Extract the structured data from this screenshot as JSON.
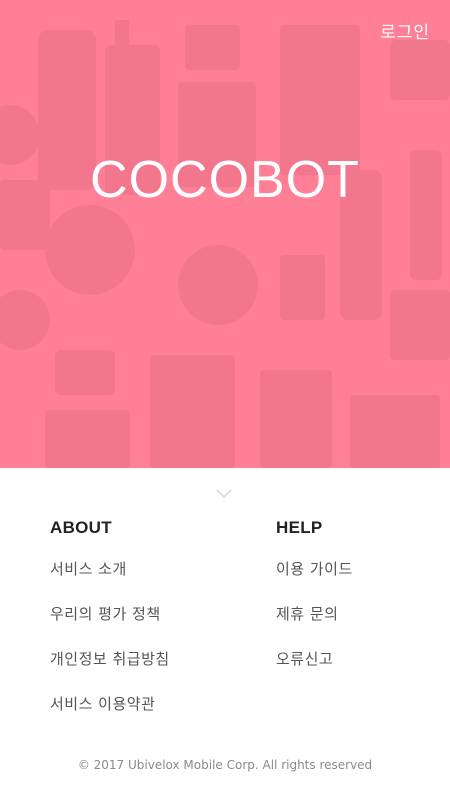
{
  "header": {
    "login_label": "로그인"
  },
  "hero": {
    "brand": "COCOBOT"
  },
  "about": {
    "title": "ABOUT",
    "items": [
      "서비스 소개",
      "우리의 평가 정책",
      "개인정보 취급방침",
      "서비스 이용약관"
    ]
  },
  "help": {
    "title": "HELP",
    "items": [
      "이용 가이드",
      "제휴 문의",
      "오류신고"
    ]
  },
  "footer": {
    "copyright": "© 2017 Ubivelox Mobile Corp. All rights reserved"
  },
  "icons": {
    "scroll": "chevron-down-icon"
  },
  "colors": {
    "hero_tint": "#ff8096",
    "text_dark": "#222222",
    "text_link": "#555555"
  }
}
